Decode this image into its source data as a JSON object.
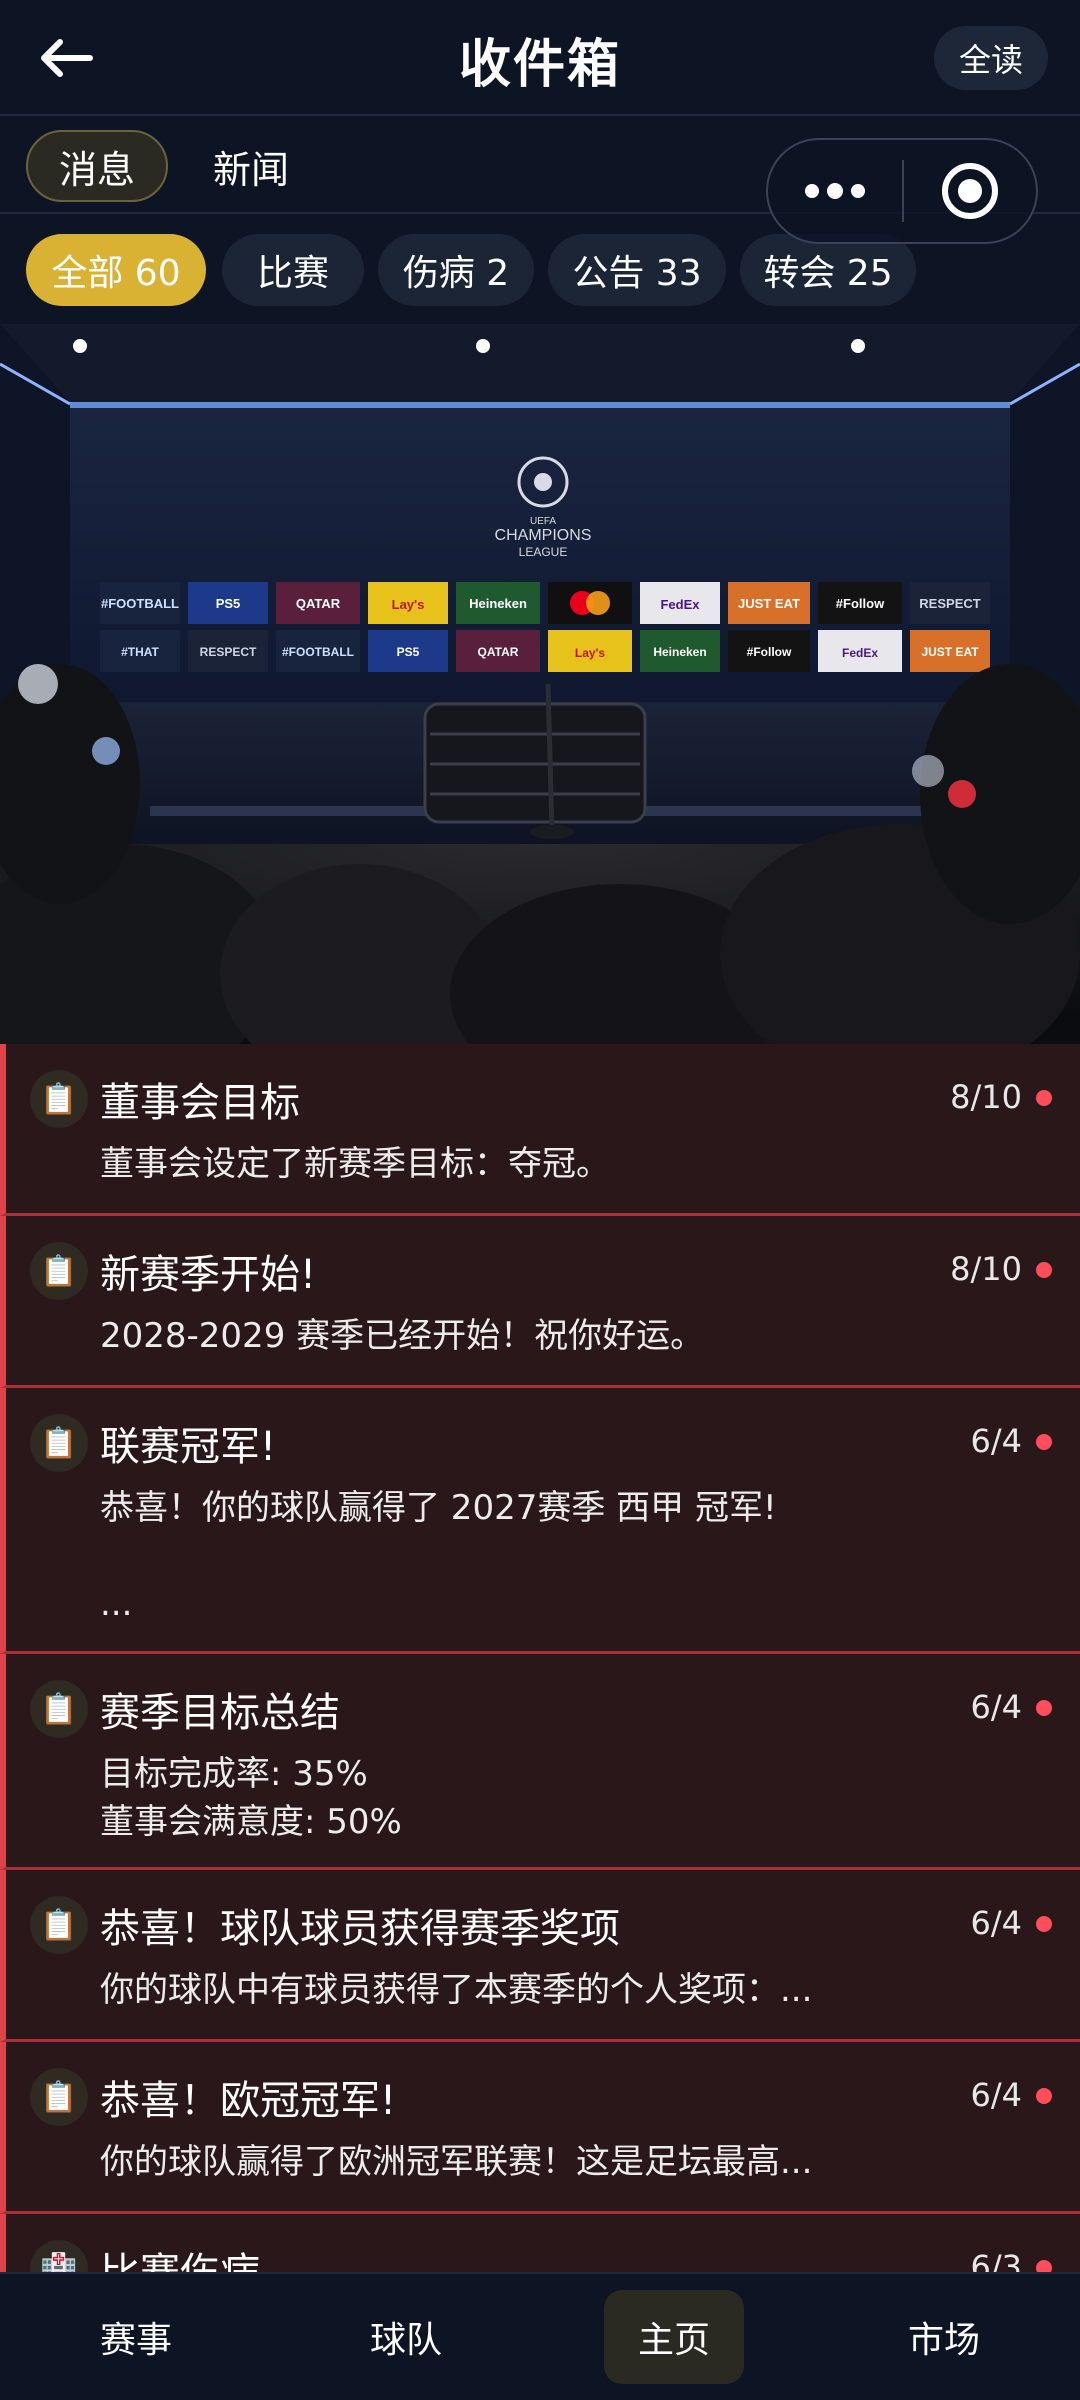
{
  "header": {
    "title": "收件箱",
    "read_all_label": "全读"
  },
  "type_tabs": [
    {
      "label": "消息",
      "active": true
    },
    {
      "label": "新闻",
      "active": false
    }
  ],
  "filters": [
    {
      "label": "全部 60",
      "active": true
    },
    {
      "label": "比赛",
      "active": false
    },
    {
      "label": "伤病 2",
      "active": false
    },
    {
      "label": "公告 33",
      "active": false
    },
    {
      "label": "转会 25",
      "active": false
    }
  ],
  "hero": {
    "logo_lines": [
      "UEFA",
      "CHAMPIONS",
      "LEAGUE"
    ],
    "board_row1": [
      "#FOOTBALL",
      "PS5",
      "QATAR AIRWAYS",
      "Lay's",
      "Heineken",
      "mastercard",
      "FedEx",
      "JUST EAT",
      "#Follow Scores",
      "RESPECT"
    ],
    "board_row2": [
      "#THAT #UCLFEELING",
      "RESPECT",
      "#FOOTBALL",
      "PS5",
      "QATAR AIRWAYS",
      "Lay's",
      "Heineken",
      "#Follow Scores",
      "FedEx",
      "JUST EAT"
    ]
  },
  "messages": [
    {
      "icon": "📋",
      "title": "董事会目标",
      "date": "8/10",
      "body": "董事会设定了新赛季目标：夺冠。"
    },
    {
      "icon": "📋",
      "title": "新赛季开始!",
      "date": "8/10",
      "body": "2028-2029 赛季已经开始！祝你好运。"
    },
    {
      "icon": "📋",
      "title": "联赛冠军!",
      "date": "6/4",
      "body": "恭喜！你的球队赢得了 2027赛季 西甲 冠军!\n\n..."
    },
    {
      "icon": "📋",
      "title": "赛季目标总结",
      "date": "6/4",
      "body": "目标完成率: 35%\n董事会满意度: 50%"
    },
    {
      "icon": "📋",
      "title": "恭喜！球队球员获得赛季奖项",
      "date": "6/4",
      "body": "你的球队中有球员获得了本赛季的个人奖项：..."
    },
    {
      "icon": "📋",
      "title": "恭喜！欧冠冠军!",
      "date": "6/4",
      "body": "你的球队赢得了欧洲冠军联赛！这是足坛最高..."
    },
    {
      "icon": "🏥",
      "title": "比赛伤病",
      "date": "6/3",
      "body": ""
    }
  ],
  "bottom_nav": [
    {
      "label": "赛事",
      "active": false
    },
    {
      "label": "球队",
      "active": false
    },
    {
      "label": "主页",
      "active": true
    },
    {
      "label": "市场",
      "active": false
    }
  ],
  "colors": {
    "background": "#0d1424",
    "accent_gold": "#d9b233",
    "unread_red": "#e3414a",
    "message_bg": "#2a1719"
  }
}
